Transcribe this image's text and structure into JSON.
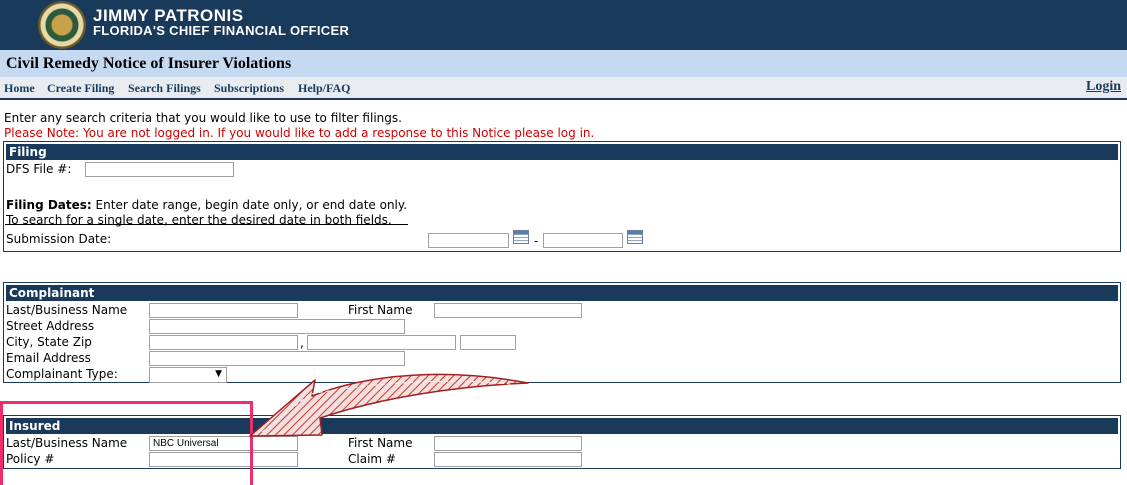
{
  "header": {
    "name": "JIMMY PATRONIS",
    "title": "FLORIDA'S CHIEF FINANCIAL OFFICER"
  },
  "page": {
    "title": "Civil Remedy Notice of Insurer Violations"
  },
  "nav": {
    "items": [
      {
        "label": "Home"
      },
      {
        "label": "Create Filing"
      },
      {
        "label": "Search Filings"
      },
      {
        "label": "Subscriptions"
      },
      {
        "label": "Help/FAQ"
      }
    ],
    "login": "Login"
  },
  "intro": {
    "text": "Enter any search criteria that you would like to use to filter filings.",
    "note": "Please Note: You are not logged in. If you would like to add a response to this Notice please log in."
  },
  "filing": {
    "heading": "Filing",
    "dfs_label": "DFS File #:",
    "dfs_value": "",
    "dates_label": "Filing Dates:",
    "dates_hint_1": " Enter date range, begin date only, or end date only.",
    "dates_hint_2": "To search for a single date, enter the desired date in both fields.",
    "submission_label": "Submission Date:",
    "date_separator": "-",
    "start_date": "",
    "end_date": ""
  },
  "complainant": {
    "heading": "Complainant",
    "last_name_label": "Last/Business Name",
    "first_name_label": "First Name",
    "street_label": "Street Address",
    "city_label": "City, State Zip",
    "email_label": "Email Address",
    "type_label": "Complainant Type:",
    "city_separator": ",",
    "type_value": ""
  },
  "insured": {
    "heading": "Insured",
    "last_name_label": "Last/Business Name",
    "last_name_value": "NBC Universal",
    "first_name_label": "First Name",
    "policy_label": "Policy #",
    "claim_label": "Claim #"
  },
  "annotation": {
    "highlight_color": "#ef2d6a",
    "arrow_color": "#c0392b"
  }
}
